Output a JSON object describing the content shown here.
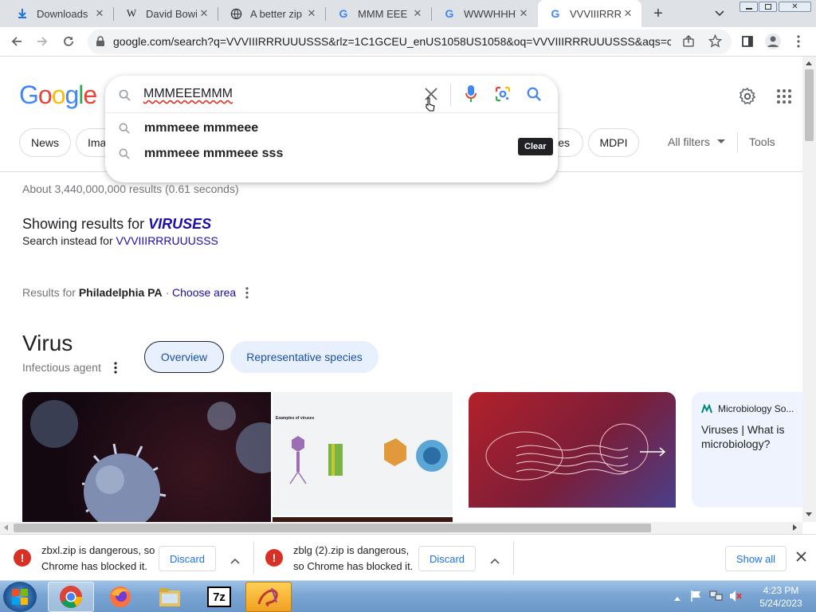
{
  "tabs": [
    {
      "title": "Downloads",
      "icon": "download-icon"
    },
    {
      "title": "David Bowie",
      "icon": "wikipedia-icon"
    },
    {
      "title": "A better zip",
      "icon": "globe-icon"
    },
    {
      "title": "MMM EEE M",
      "icon": "google-icon"
    },
    {
      "title": "WWWHHHY",
      "icon": "google-icon"
    },
    {
      "title": "VVVIIIRRRU",
      "icon": "google-icon"
    }
  ],
  "address_bar": {
    "url": "google.com/search?q=VVVIIIRRRUUUSSS&rlz=1C1GCEU_enUS1058US1058&oq=VVVIIIRRRUUUSSS&aqs=chro..."
  },
  "logo": {
    "letters": [
      "G",
      "o",
      "o",
      "g",
      "l",
      "e"
    ],
    "colors": [
      "#4285f4",
      "#ea4335",
      "#fbbc05",
      "#4285f4",
      "#34a853",
      "#ea4335"
    ]
  },
  "search": {
    "value": "MMMEEEMMM",
    "tooltip": "Clear",
    "suggestions": [
      "mmmeee mmmeee",
      "mmmeee mmmeee sss"
    ]
  },
  "filters": {
    "chips": [
      "News",
      "Ima",
      "ies",
      "MDPI"
    ],
    "all_filters": "All filters",
    "tools": "Tools"
  },
  "results": {
    "stats": "About 3,440,000,000 results (0.61 seconds)",
    "showing_prefix": "Showing results for ",
    "showing_term": "VIRUSES",
    "instead_prefix": "Search instead for ",
    "instead_term": "VVVIIIRRRUUUSSS",
    "location_prefix": "Results for ",
    "location": "Philadelphia PA",
    "location_sep": " · ",
    "choose_area": "Choose area"
  },
  "entity": {
    "title": "Virus",
    "subtitle": "Infectious agent",
    "tabs": [
      "Overview",
      "Representative species"
    ],
    "source_name": "Microbiology So...",
    "article_title": "Viruses | What is microbiology?",
    "diagram_caption": "Examples of viruses"
  },
  "downloads": [
    {
      "line1": "zbxl.zip is dangerous, so",
      "line2": "Chrome has blocked it.",
      "action": "Discard"
    },
    {
      "line1": "zblg (2).zip is dangerous,",
      "line2": "so Chrome has blocked it.",
      "action": "Discard"
    }
  ],
  "download_bar": {
    "show_all": "Show all"
  },
  "taskbar": {
    "time": "4:23 PM",
    "date": "5/24/2023",
    "apps": [
      "chrome-icon",
      "firefox-icon",
      "file-explorer-icon",
      "7zip-icon",
      "paint-icon"
    ]
  }
}
